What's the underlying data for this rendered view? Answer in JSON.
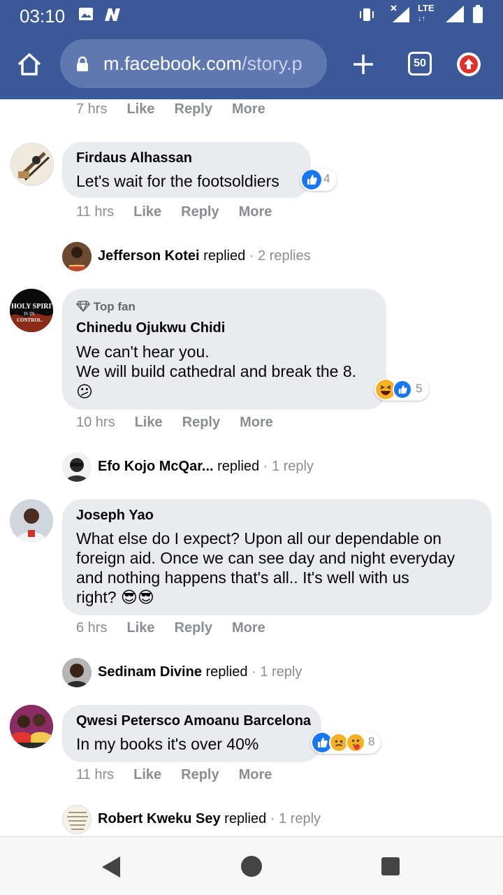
{
  "status_bar": {
    "time": "03:10",
    "network": "LTE",
    "icons": [
      "image-icon",
      "n-app-icon",
      "vibrate-icon",
      "signal-x-icon",
      "lte-icon",
      "signal-icon",
      "battery-icon"
    ]
  },
  "browser": {
    "url_host": "m.facebook.com",
    "url_path": "/story.p",
    "tab_count": "50"
  },
  "comments": [
    {
      "time": "7 hrs",
      "like": "Like",
      "reply": "Reply",
      "more": "More"
    },
    {
      "name": "Firdaus Alhassan",
      "text": "Let's wait for the footsoldiers",
      "reaction_count": "4",
      "time": "11 hrs",
      "like": "Like",
      "reply": "Reply",
      "more": "More",
      "replies": {
        "name": "Jefferson Kotei",
        "verb": "replied",
        "count": " · 2 replies"
      }
    },
    {
      "badge": "Top fan",
      "name": "Chinedu Ojukwu Chidi",
      "text_line1": "We can't hear you.",
      "text_line2": "We will build cathedral and break the 8.",
      "emoji": "😕",
      "reaction_count": "5",
      "time": "10 hrs",
      "like": "Like",
      "reply": "Reply",
      "more": "More",
      "replies": {
        "name": "Efo Kojo McQar...",
        "verb": "replied",
        "count": " · 1 reply"
      },
      "avatar_text": [
        "HOLY SPIRIT",
        "IS IN",
        "CONTROL."
      ]
    },
    {
      "name": "Joseph Yao",
      "text_line1": "What else do I expect? Upon all our dependable on",
      "text_line2": "foreign aid. Once we can see day and night everyday",
      "text_line3": "and nothing happens that's all.. It's well with us",
      "text_line4": "right? 😎😎",
      "time": "6 hrs",
      "like": "Like",
      "reply": "Reply",
      "more": "More",
      "replies": {
        "name": "Sedinam Divine",
        "verb": "replied",
        "count": " · 1 reply"
      }
    },
    {
      "name": "Qwesi Petersco Amoanu Barcelona",
      "text": "In my books it's over 40%",
      "reaction_count": "8",
      "time": "11 hrs",
      "like": "Like",
      "reply": "Reply",
      "more": "More",
      "replies": {
        "name": "Robert Kweku Sey",
        "verb": "replied",
        "count": " · 1 reply"
      }
    }
  ],
  "colors": {
    "brand_bar": "#3b5998",
    "bubble": "#eaebef",
    "like_blue": "#1877f2",
    "meta_gray": "#8a8d91",
    "update_red": "#e0302a"
  }
}
